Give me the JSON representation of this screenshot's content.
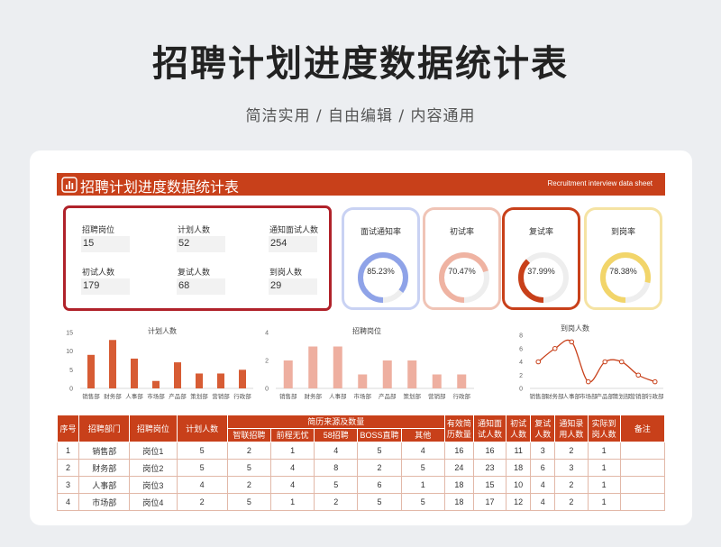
{
  "poster": {
    "title": "招聘计划进度数据统计表",
    "subtitle": "简洁实用 / 自由编辑 / 内容通用"
  },
  "banner": {
    "title": "招聘计划进度数据统计表",
    "subtitle": "Recruitment interview data sheet",
    "icon": "bar-chart-icon"
  },
  "kpis": [
    {
      "label": "招聘岗位",
      "value": "15"
    },
    {
      "label": "计划人数",
      "value": "52"
    },
    {
      "label": "通知面试人数",
      "value": "254"
    },
    {
      "label": "初试人数",
      "value": "179"
    },
    {
      "label": "复试人数",
      "value": "68"
    },
    {
      "label": "到岗人数",
      "value": "29"
    }
  ],
  "gauges": [
    {
      "label": "面试通知率",
      "value": "85.23%",
      "fraction": 0.8523,
      "color": "#8fa3e8",
      "border": "#c9d2f3"
    },
    {
      "label": "初试率",
      "value": "70.47%",
      "fraction": 0.7047,
      "color": "#efb3a2",
      "border": "#f0c4b6"
    },
    {
      "label": "复试率",
      "value": "37.99%",
      "fraction": 0.3799,
      "color": "#c8401a",
      "border": "#c8401a"
    },
    {
      "label": "到岗率",
      "value": "78.38%",
      "fraction": 0.7838,
      "color": "#f2d56a",
      "border": "#f5e3a3"
    }
  ],
  "chart_data": [
    {
      "type": "bar",
      "title": "计划人数",
      "categories": [
        "销售部",
        "财务部",
        "人事部",
        "市场部",
        "产品部",
        "策划部",
        "营销部",
        "行政部"
      ],
      "values": [
        9,
        13,
        8,
        2,
        7,
        4,
        4,
        5
      ],
      "ylim": [
        0,
        15
      ],
      "yticks": [
        0,
        5,
        10,
        15
      ],
      "color": "#d75c34"
    },
    {
      "type": "bar",
      "title": "招聘岗位",
      "categories": [
        "销售部",
        "财务部",
        "人事部",
        "市场部",
        "产品部",
        "策划部",
        "营销部",
        "行政部"
      ],
      "values": [
        2,
        3,
        3,
        1,
        2,
        2,
        1,
        1
      ],
      "ylim": [
        0,
        4
      ],
      "yticks": [
        0,
        2,
        4
      ],
      "color": "#eeafa0"
    },
    {
      "type": "line",
      "title": "到岗人数",
      "categories": [
        "销售部",
        "财务部",
        "人事部",
        "市场部",
        "产品部",
        "策划部",
        "营销部",
        "行政部"
      ],
      "values": [
        4,
        6,
        7,
        1,
        4,
        4,
        2,
        1
      ],
      "ylim": [
        0,
        8
      ],
      "yticks": [
        0,
        2,
        4,
        6,
        8
      ],
      "color": "#c8401a"
    }
  ],
  "table": {
    "headers_top": [
      "序号",
      "招聘部门",
      "招聘岗位",
      "计划人数",
      "简历来源及数量",
      "有效简历数量",
      "通知面试人数",
      "初试人数",
      "复试人数",
      "通知录用人数",
      "实际到岗人数",
      "备注"
    ],
    "headers_sub": [
      "智联招聘",
      "前程无忧",
      "58招聘",
      "BOSS直聘",
      "其他"
    ],
    "rows": [
      [
        "1",
        "销售部",
        "岗位1",
        "5",
        "2",
        "1",
        "4",
        "5",
        "4",
        "16",
        "16",
        "11",
        "3",
        "2",
        "1",
        ""
      ],
      [
        "2",
        "财务部",
        "岗位2",
        "5",
        "5",
        "4",
        "8",
        "2",
        "5",
        "24",
        "23",
        "18",
        "6",
        "3",
        "1",
        ""
      ],
      [
        "3",
        "人事部",
        "岗位3",
        "4",
        "2",
        "4",
        "5",
        "6",
        "1",
        "18",
        "15",
        "10",
        "4",
        "2",
        "1",
        ""
      ],
      [
        "4",
        "市场部",
        "岗位4",
        "2",
        "5",
        "1",
        "2",
        "5",
        "5",
        "18",
        "17",
        "12",
        "4",
        "2",
        "1",
        ""
      ]
    ]
  }
}
